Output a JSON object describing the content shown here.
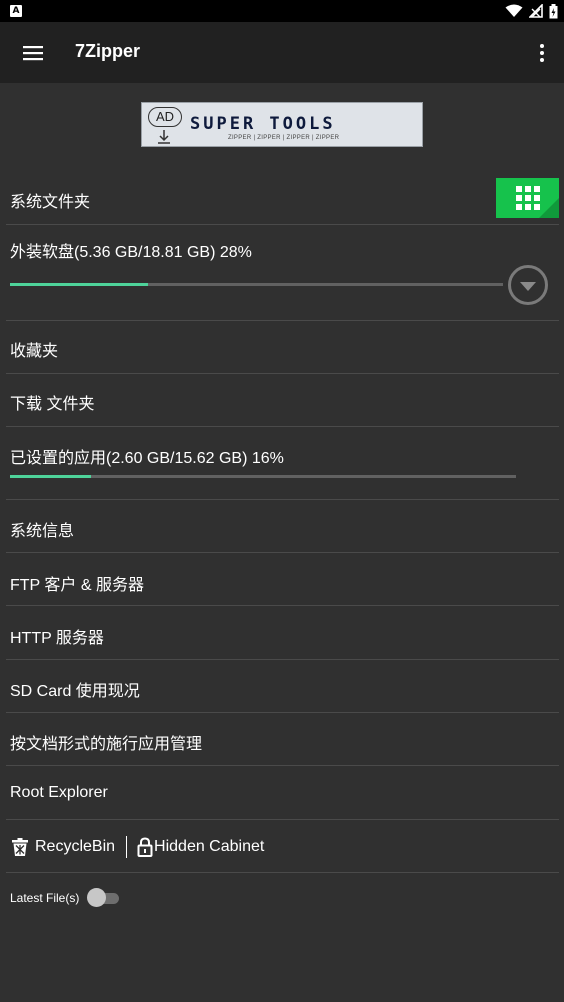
{
  "statusbar": {
    "notification_glyph": "A",
    "icons": [
      "wifi-icon",
      "signal-icon",
      "battery-icon"
    ]
  },
  "appbar": {
    "title": "7Zipper",
    "menu_icon": "menu-icon",
    "overflow_icon": "more-vert-icon"
  },
  "ad": {
    "badge": "AD",
    "title": "SUPER TOOLS",
    "subtitle": "ZIPPER | ZIPPER | ZIPPER | ZIPPER"
  },
  "list": {
    "system_folder": "系统文件夹",
    "external_storage": {
      "label": "外装软盘(5.36 GB/18.81 GB) 28%",
      "progress": 0.28
    },
    "favorites": "收藏夹",
    "download_folder": "下载 文件夹",
    "installed_apps": {
      "label": "已设置的应用(2.60 GB/15.62 GB) 16%",
      "progress": 0.16
    },
    "system_info": "系统信息",
    "ftp": "FTP 客户 & 服务器",
    "http": "HTTP 服务器",
    "sdcard": "SD Card 使用现况",
    "app_manager": "按文档形式的施行应用管理",
    "root_explorer": "Root Explorer",
    "recycle_bin": "RecycleBin",
    "hidden_cabinet": "Hidden Cabinet",
    "latest_files": "Latest File(s)",
    "latest_files_enabled": false
  },
  "colors": {
    "accent": "#4ed39a",
    "grid_button": "#16c24c",
    "background": "#303030",
    "appbar": "#212121"
  }
}
